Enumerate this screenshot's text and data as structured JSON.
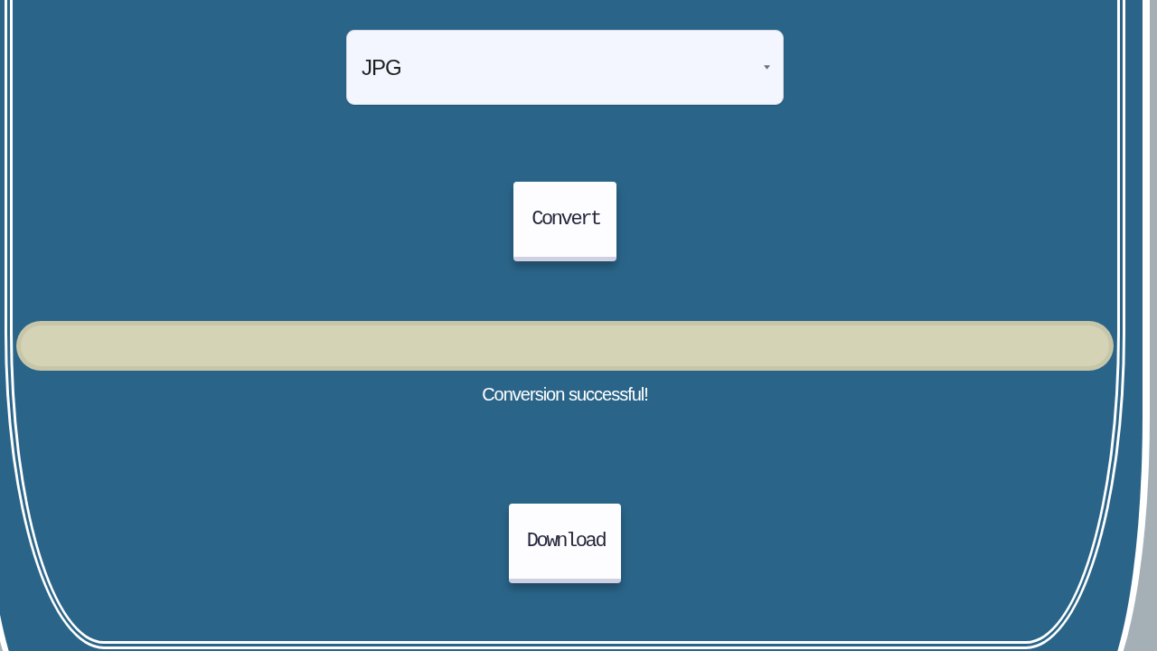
{
  "format_dropdown": {
    "value": "JPG"
  },
  "convert_button": {
    "label": "Convert"
  },
  "progress": {
    "level": 1
  },
  "status_message": "Conversion successful!",
  "download_button": {
    "label": "Download"
  }
}
